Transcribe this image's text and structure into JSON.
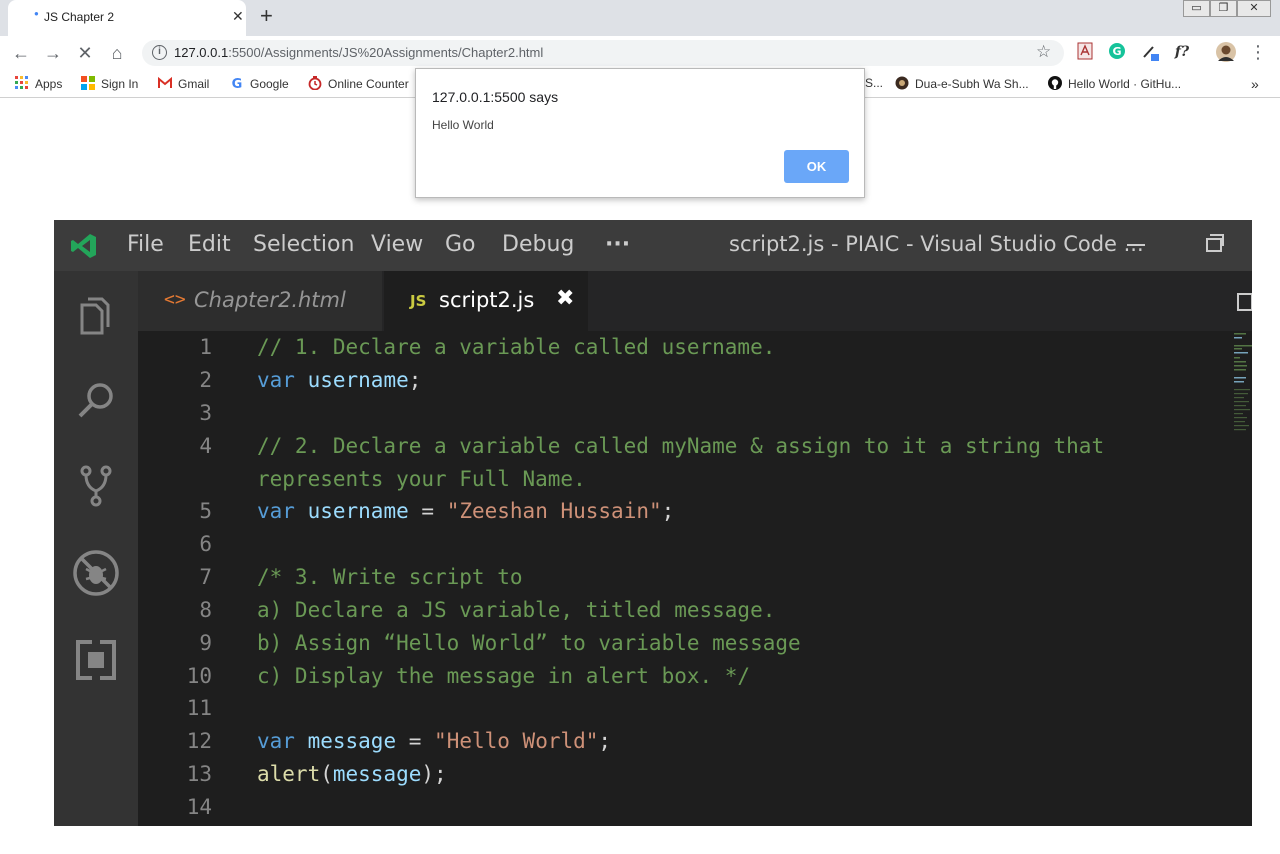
{
  "browser": {
    "tab_title": "JS Chapter 2",
    "url_host": "127.0.0.1",
    "url_rest": ":5500/Assignments/JS%20Assignments/Chapter2.html",
    "bookmarks": [
      "Apps",
      "Sign In",
      "Gmail",
      "Google",
      "Online Counter",
      "Dua-e-Subh Wa Sh...",
      "Hello World · GitHu..."
    ],
    "bookmark_cut_fragment": "S..."
  },
  "dialog": {
    "title": "127.0.0.1:5500 says",
    "message": "Hello World",
    "ok_label": "OK"
  },
  "vscode": {
    "menu": [
      "File",
      "Edit",
      "Selection",
      "View",
      "Go",
      "Debug",
      "···"
    ],
    "window_title": "script2.js - PIAIC - Visual Studio Code ...",
    "tabs": [
      {
        "icon": "<>",
        "label": "Chapter2.html"
      },
      {
        "icon": "JS",
        "label": "script2.js",
        "close": "✖"
      }
    ],
    "line_numbers": [
      "1",
      "2",
      "3",
      "4",
      "5",
      "6",
      "7",
      "8",
      "9",
      "10",
      "11",
      "12",
      "13",
      "14"
    ],
    "code": {
      "l1": "// 1. Declare a variable called username.",
      "l2_kw": "var",
      "l2_var": "username",
      "l2_end": ";",
      "l4a": "// 2. Declare a variable called myName & assign to it a string that",
      "l4b": "represents your Full Name.",
      "l5_kw": "var",
      "l5_var": "username",
      "l5_op": " = ",
      "l5_str": "\"Zeeshan Hussain\"",
      "l5_end": ";",
      "l7": "/* 3. Write script to",
      "l8": "a) Declare a JS variable, titled message.",
      "l9": "b) Assign “Hello World” to variable message",
      "l10": "c) Display the message in alert box. */",
      "l12_kw": "var",
      "l12_var": "message",
      "l12_op": " = ",
      "l12_str": "\"Hello World\"",
      "l12_end": ";",
      "l13_fn": "alert",
      "l13_open": "(",
      "l13_var": "message",
      "l13_end": ");"
    }
  },
  "colors": {
    "comment": "#6a9955",
    "keyword": "#569cd6",
    "variable": "#9cdcfe",
    "string": "#ce9178",
    "function": "#dcdcaa",
    "ok_button": "#6aa7f8"
  }
}
